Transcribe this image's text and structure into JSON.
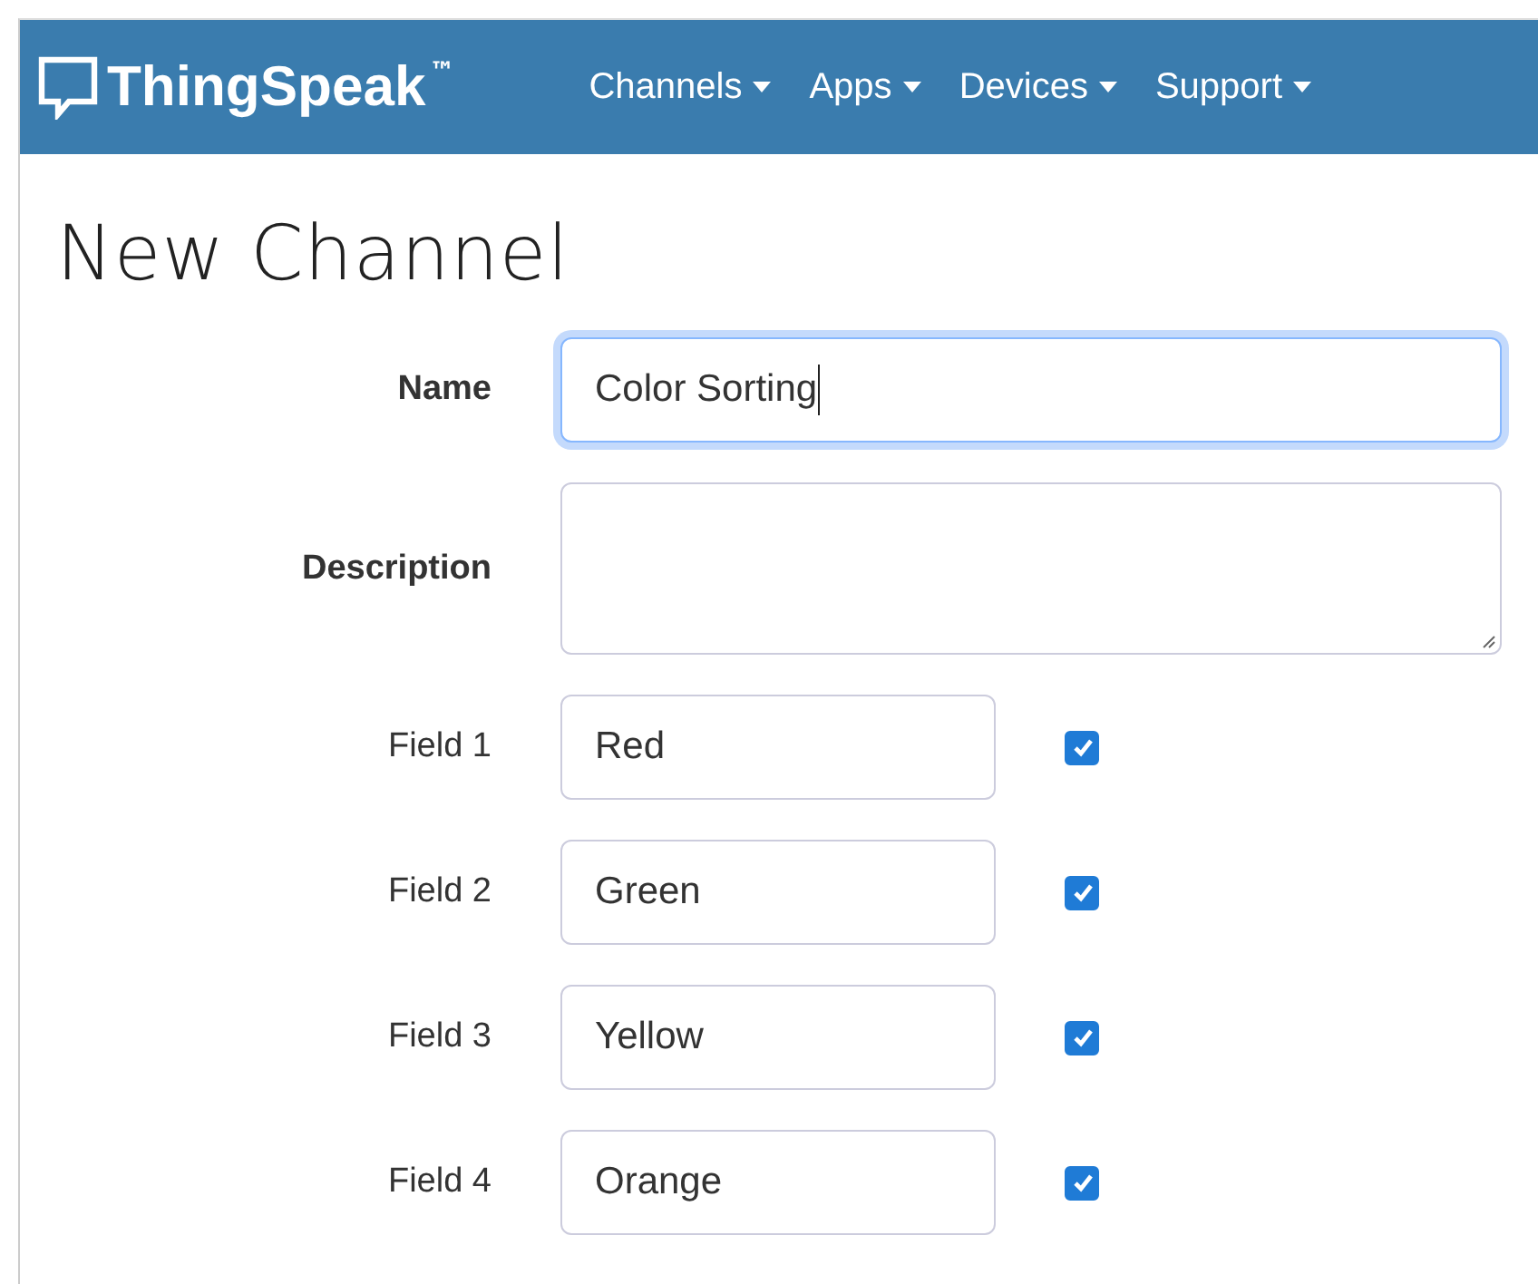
{
  "navbar": {
    "brand": "ThingSpeak",
    "trademark": "™",
    "menus": [
      {
        "label": "Channels"
      },
      {
        "label": "Apps"
      },
      {
        "label": "Devices"
      },
      {
        "label": "Support"
      }
    ]
  },
  "page_title": "New Channel",
  "form": {
    "name": {
      "label": "Name",
      "value": "Color Sorting",
      "focused": true
    },
    "description": {
      "label": "Description"
    },
    "fields": [
      {
        "label": "Field 1",
        "value": "Red",
        "checked": true
      },
      {
        "label": "Field 2",
        "value": "Green",
        "checked": true
      },
      {
        "label": "Field 3",
        "value": "Yellow",
        "checked": true
      },
      {
        "label": "Field 4",
        "value": "Orange",
        "checked": true
      }
    ]
  }
}
